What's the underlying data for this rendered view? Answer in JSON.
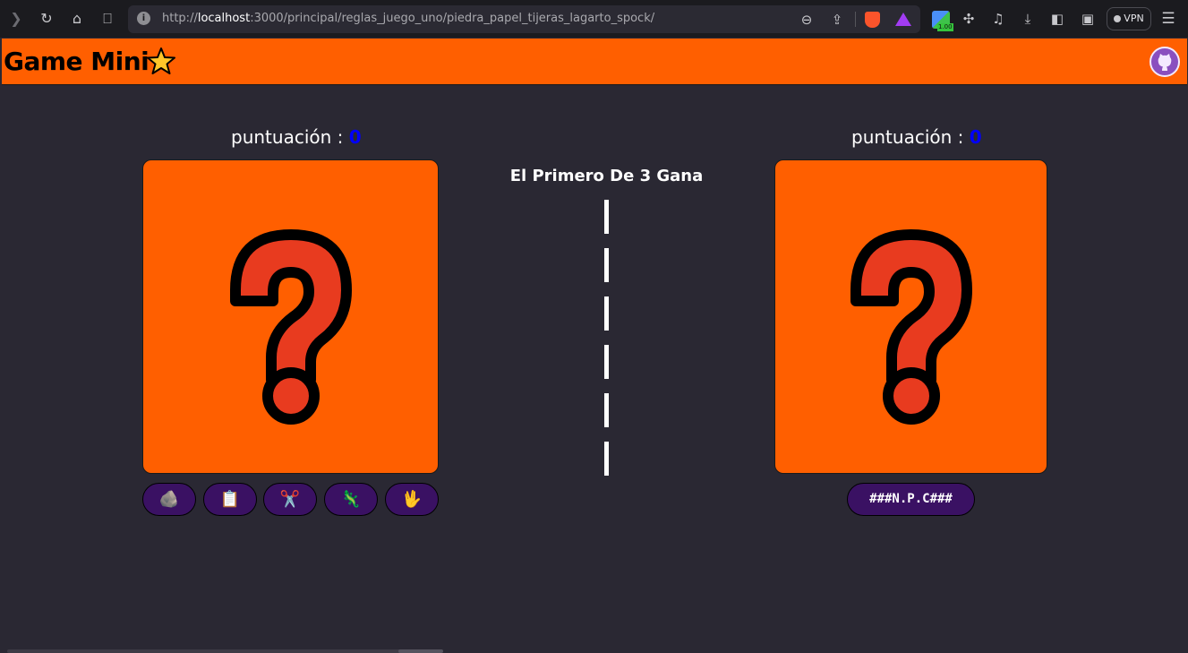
{
  "browser": {
    "url_prefix": "http://",
    "url_host": "localhost",
    "url_rest": ":3000/principal/reglas_juego_uno/piedra_papel_tijeras_lagarto_spock/",
    "vpn_label": "VPN",
    "ext_badge": "1.00"
  },
  "header": {
    "title": "Game Mini",
    "accent_color": "#ff5f00"
  },
  "player": {
    "score_label": "puntuación : ",
    "score": "0",
    "choices": [
      {
        "name": "rock",
        "glyph": "🪨"
      },
      {
        "name": "paper",
        "glyph": "📋"
      },
      {
        "name": "scissors",
        "glyph": "✂️"
      },
      {
        "name": "lizard",
        "glyph": "🦎"
      },
      {
        "name": "spock",
        "glyph": "🖖"
      }
    ]
  },
  "opponent": {
    "score_label": "puntuación : ",
    "score": "0",
    "button_label": "###N.P.C###"
  },
  "center": {
    "rule_text": "El Primero De 3 Gana"
  }
}
